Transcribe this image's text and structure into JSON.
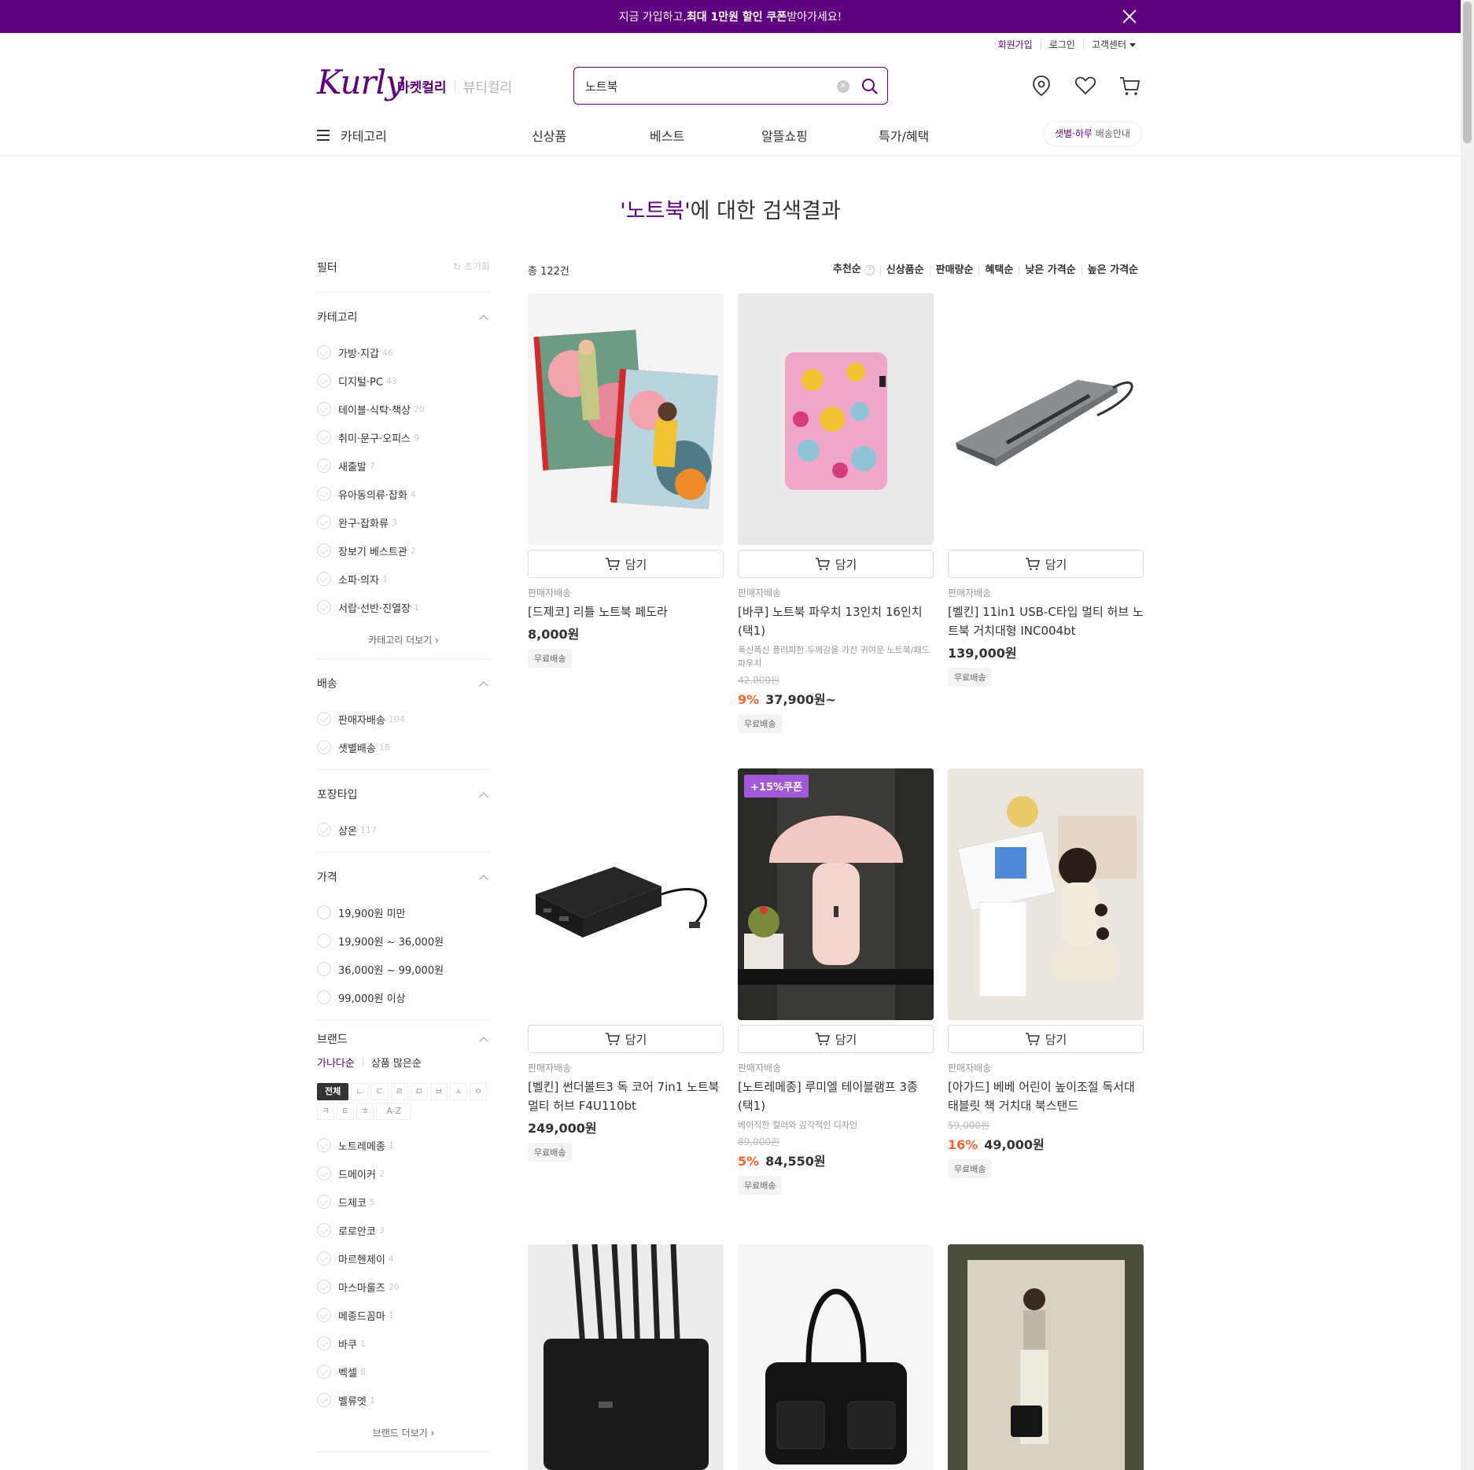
{
  "promo": {
    "pre": "지금 가입하고, ",
    "bold": "최대 1만원 할인 쿠폰",
    "post": " 받아가세요!"
  },
  "util": [
    "회원가입",
    "로그인",
    "고객센터"
  ],
  "header": {
    "logo": "Kurly",
    "tabs": [
      "마켓컬리",
      "뷰티컬리"
    ],
    "search_value": "노트북"
  },
  "nav": {
    "category": "카테고리",
    "menus": [
      "신상품",
      "베스트",
      "알뜰쇼핑",
      "특가/혜택"
    ],
    "delivery_hi": "샛별·하루",
    "delivery_rest": " 배송안내"
  },
  "title": {
    "keyword": "'노트북'",
    "rest": "에 대한 검색결과"
  },
  "filter": {
    "title": "필터",
    "reset": "초기화",
    "category": {
      "title": "카테고리",
      "items": [
        {
          "label": "가방·지갑",
          "count": "46"
        },
        {
          "label": "디지털·PC",
          "count": "43"
        },
        {
          "label": "테이블·식탁·책상",
          "count": "20"
        },
        {
          "label": "취미·문구·오피스",
          "count": "9"
        },
        {
          "label": "새출발",
          "count": "7"
        },
        {
          "label": "유아동의류·잡화",
          "count": "4"
        },
        {
          "label": "완구·잡화류",
          "count": "3"
        },
        {
          "label": "장보기 베스트관",
          "count": "2"
        },
        {
          "label": "소파·의자",
          "count": "1"
        },
        {
          "label": "서랍·선반·진열장",
          "count": "1"
        }
      ],
      "more": "카테고리 더보기"
    },
    "delivery": {
      "title": "배송",
      "items": [
        {
          "label": "판매자배송",
          "count": "104"
        },
        {
          "label": "샛별배송",
          "count": "18"
        }
      ]
    },
    "package": {
      "title": "포장타입",
      "items": [
        {
          "label": "상온",
          "count": "117"
        }
      ]
    },
    "price": {
      "title": "가격",
      "items": [
        "19,900원 미만",
        "19,900원 ~ 36,000원",
        "36,000원 ~ 99,000원",
        "99,000원 이상"
      ]
    },
    "brand": {
      "title": "브랜드",
      "sort_active": "가나다순",
      "sort_other": "상품 많은순",
      "chips": [
        "전체",
        "ㄴ",
        "ㄷ",
        "ㄹ",
        "ㅁ",
        "ㅂ",
        "ㅅ",
        "ㅇ",
        "ㅋ",
        "ㅌ",
        "ㅎ",
        "A-Z"
      ],
      "items": [
        {
          "label": "노트레메종",
          "count": "1"
        },
        {
          "label": "드메이커",
          "count": "2"
        },
        {
          "label": "드제코",
          "count": "5"
        },
        {
          "label": "로로안코",
          "count": "3"
        },
        {
          "label": "마르헨제이",
          "count": "4"
        },
        {
          "label": "마스마룰즈",
          "count": "20"
        },
        {
          "label": "메종드꼼마",
          "count": "1"
        },
        {
          "label": "바쿠",
          "count": "1"
        },
        {
          "label": "벡셀",
          "count": "8"
        },
        {
          "label": "벨류엣",
          "count": "1"
        }
      ],
      "more": "브랜드 더보기"
    }
  },
  "list": {
    "total": "총 122건",
    "sorts": [
      "추천순",
      "신상품순",
      "판매량순",
      "혜택순",
      "낮은 가격순",
      "높은 가격순"
    ],
    "cart_label": "담기",
    "products": [
      {
        "seller": "판매자배송",
        "name": "[드제코] 리틀 노트북 페도라",
        "desc": "",
        "orig": "",
        "rate": "",
        "price": "8,000원",
        "badge": "무료배송",
        "coupon": ""
      },
      {
        "seller": "판매자배송",
        "name": "[바쿠] 노트북 파우치 13인치 16인치 (택1)",
        "desc": "폭신폭신 플러피한 두께감을 가진 귀여운 노트북/패드 파우치",
        "orig": "42,000원",
        "rate": "9%",
        "price": "37,900원~",
        "badge": "무료배송",
        "coupon": ""
      },
      {
        "seller": "판매자배송",
        "name": "[벨킨] 11in1 USB-C타입 멀티 허브 노트북 거치대형 INC004bt",
        "desc": "",
        "orig": "",
        "rate": "",
        "price": "139,000원",
        "badge": "무료배송",
        "coupon": ""
      },
      {
        "seller": "판매자배송",
        "name": "[벨킨] 썬더볼트3 독 코어 7in1 노트북 멀티 허브 F4U110bt",
        "desc": "",
        "orig": "",
        "rate": "",
        "price": "249,000원",
        "badge": "무료배송",
        "coupon": ""
      },
      {
        "seller": "판매자배송",
        "name": "[노트레메종] 루미엘 테이블램프 3종 (택1)",
        "desc": "베이직한 컬러와 감각적인 디자인",
        "orig": "89,000원",
        "rate": "5%",
        "price": "84,550원",
        "badge": "무료배송",
        "coupon": "+15%쿠폰"
      },
      {
        "seller": "판매자배송",
        "name": "[아가드] 베베 어린이 높이조절 독서대 태블릿 책 거치대 북스탠드",
        "desc": "",
        "orig": "59,000원",
        "rate": "16%",
        "price": "49,000원",
        "badge": "무료배송",
        "coupon": ""
      }
    ]
  },
  "colors": {
    "brand": "#5f0080",
    "discount": "#fa622f",
    "coupon": "#a259d9"
  }
}
